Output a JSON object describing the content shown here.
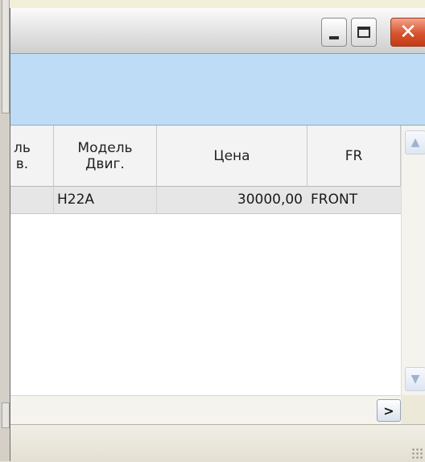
{
  "window": {
    "minimize_label": "_",
    "maximize_label": "□",
    "close_label": "✕"
  },
  "grid": {
    "columns": [
      {
        "label": "ль\nв."
      },
      {
        "label": "Модель\nДвиг."
      },
      {
        "label": "Цена"
      },
      {
        "label": "FR"
      }
    ],
    "rows": [
      {
        "col_a": "",
        "col_b": "H22A",
        "col_c": "30000,00",
        "col_d": "FRONT"
      }
    ]
  },
  "scrollbars": {
    "up_icon": "scroll-up-icon",
    "down_icon": "scroll-down-icon",
    "right_icon": "scroll-right-icon"
  },
  "colors": {
    "toolbar_band": "#bedcf6",
    "row_selected": "#e6e6e6",
    "close_button": "#d6542e"
  }
}
